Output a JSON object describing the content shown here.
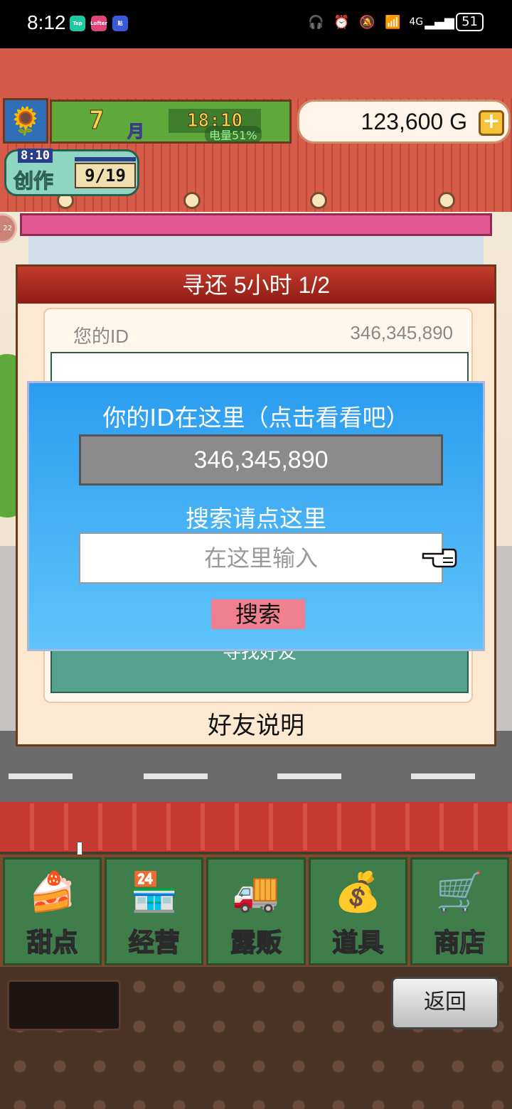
{
  "status_bar": {
    "time": "8:12",
    "apps": [
      {
        "name": "tap-app-icon",
        "text": "Tap",
        "color": "#1ec8a0"
      },
      {
        "name": "lofter-app-icon",
        "text": "Lofter",
        "color": "#e0457a"
      },
      {
        "name": "tieba-app-icon",
        "text": "贴",
        "color": "#3a5ad8"
      }
    ],
    "battery": "51",
    "network": "4G"
  },
  "header": {
    "month_num": "7",
    "month_label": "月",
    "clock": "18:10",
    "battery_overlay": "电量51%",
    "gold": "123,600 G",
    "gold_plus": "+"
  },
  "create_badge": {
    "time": "8:10",
    "label": "创作",
    "count": "9/19"
  },
  "side_badge": "22",
  "panel": {
    "title": "寻还  5小时 1/2",
    "id_label": "您的ID",
    "id_value": "346,345,890",
    "find_friends": "寻找好友",
    "footer": "好友说明"
  },
  "dialog": {
    "title": "你的ID在这里（点击看看吧）",
    "id_value": "346,345,890",
    "search_hint": "搜索请点这里",
    "search_placeholder": "在这里输入",
    "search_button": "搜索"
  },
  "menu": [
    {
      "label": "甜点",
      "icon": "🍰",
      "name": "menu-dessert"
    },
    {
      "label": "经营",
      "icon": "🏪",
      "name": "menu-manage"
    },
    {
      "label": "露贩",
      "icon": "🚚",
      "name": "menu-stall"
    },
    {
      "label": "道具",
      "icon": "💰",
      "name": "menu-items"
    },
    {
      "label": "商店",
      "icon": "🛒",
      "name": "menu-shop"
    }
  ],
  "back_button": "返回",
  "colors": {
    "dialog_bg": "#2b9cf0",
    "search_button": "#f08090",
    "menu_bg": "#3f7e4a",
    "panel_title": "#c33b2c"
  }
}
